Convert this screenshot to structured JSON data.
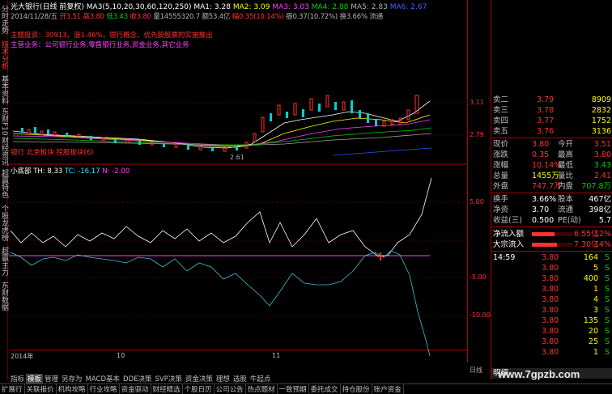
{
  "left_tabs": [
    "分时走势",
    "技术分析",
    "基本资料",
    "东财F10",
    "财经资讯",
    "超赢特色",
    "个股龙虎榜",
    "超赢主力",
    "东财数据"
  ],
  "title": {
    "stock": "光大银行(日线 前复权)",
    "ma_label": "MA3(5,10,20,30,60,120,250)",
    "ma1": "MA1: 3.28",
    "ma2": "MA2: 3.09",
    "ma3": "MA3: 3.03",
    "ma4": "MA4: 2.88",
    "ma5": "MA5: 2.83",
    "ma6": "MA6: 2.67"
  },
  "info": {
    "date": "2014/11/28/五",
    "open": "开3.51",
    "high": "高3.80",
    "low": "低3.43",
    "close": "收3.80",
    "vol": "量14555320.7",
    "amount": "额53.4亿",
    "change": "幅0.35(10.14%)",
    "amplitude": "振0.37(10.72%)",
    "turnover": "换3.66%",
    "float": "流通"
  },
  "annotations": {
    "a1": "主题投资：30913，涨1.46%，银行概念，优先股股票的实施推出",
    "a2": "主营业务：公司银行业务,零售银行业务,资金业务,其它业务",
    "a3": "银行 北京板块 控股板块(6)"
  },
  "chart": {
    "low_label": "2.61",
    "price_ticks": [
      "3.11",
      "2.79"
    ],
    "ind_title": "小底部",
    "th": "TH: 8.33",
    "tc": "TC: -16.17",
    "n": "N: -2.00",
    "ind_ticks": [
      "5.00",
      "-5.00",
      "-10.00"
    ],
    "x_labels": [
      "2014年",
      "10",
      "11"
    ],
    "corner": "日线"
  },
  "quote": {
    "asks": [
      {
        "l": "卖二",
        "p": "3.79",
        "v": "8909"
      },
      {
        "l": "卖三",
        "p": "3.78",
        "v": "2832"
      },
      {
        "l": "卖四",
        "p": "3.77",
        "v": "1752"
      },
      {
        "l": "卖五",
        "p": "3.76",
        "v": "3136"
      }
    ],
    "rows": [
      {
        "l1": "现价",
        "v1": "3.80",
        "l2": "今开",
        "v2": "3.51"
      },
      {
        "l1": "涨跌",
        "v1": "0.35",
        "l2": "最高",
        "v2": "3.80"
      },
      {
        "l1": "涨幅",
        "v1": "10.14%",
        "l2": "最低",
        "v2": "3.43"
      },
      {
        "l1": "总量",
        "v1": "1455万",
        "l2": "量比",
        "v2": "2.41"
      },
      {
        "l1": "外盘",
        "v1": "747.7万",
        "l2": "内盘",
        "v2": "707.8万"
      },
      {
        "l1": "换手",
        "v1": "3.66%",
        "l2": "股本",
        "v2": "467亿"
      },
      {
        "l1": "净资",
        "v1": "3.70",
        "l2": "流通",
        "v2": "398亿"
      },
      {
        "l1": "收益(三)",
        "v1": "0.500",
        "l2": "PE(动)",
        "v2": "5.7"
      }
    ],
    "flows": [
      {
        "l": "净流入额",
        "v": "6.55亿",
        "p": "12%",
        "fill": 0.55
      },
      {
        "l": "大宗流入",
        "v": "7.30亿",
        "p": "14%",
        "fill": 0.62
      }
    ],
    "ticks": [
      {
        "t": "14:59",
        "p": "3.80",
        "v": "164",
        "s": "S"
      },
      {
        "t": "",
        "p": "3.80",
        "v": "5",
        "s": "S"
      },
      {
        "t": "",
        "p": "3.80",
        "v": "400",
        "s": "S"
      },
      {
        "t": "",
        "p": "3.80",
        "v": "1",
        "s": "S"
      },
      {
        "t": "",
        "p": "3.80",
        "v": "4",
        "s": "S"
      },
      {
        "t": "",
        "p": "3.80",
        "v": "3",
        "s": "S"
      },
      {
        "t": "",
        "p": "3.80",
        "v": "135",
        "s": "S"
      },
      {
        "t": "",
        "p": "3.80",
        "v": "20",
        "s": "S"
      },
      {
        "t": "",
        "p": "3.80",
        "v": "25",
        "s": "S"
      },
      {
        "t": "",
        "p": "3.80",
        "v": "1",
        "s": "S"
      }
    ],
    "bottom_tab": "明细"
  },
  "bottom_tabs": [
    "指标",
    "模板",
    "管理",
    "另存为",
    "MACD基本",
    "DDE决策",
    "SVP决策",
    "资金决策",
    "理想",
    "选股",
    "牛起点"
  ],
  "status_bar": [
    "扩展行",
    "关联报价",
    "机构攻略",
    "行业攻略",
    "资金驱动",
    "财经精选",
    "个股日历",
    "公司公告",
    "热点题材",
    "一致预期",
    "委托成交",
    "持仓股份",
    "账户资金"
  ],
  "watermark": "www.7gpzb.com"
}
